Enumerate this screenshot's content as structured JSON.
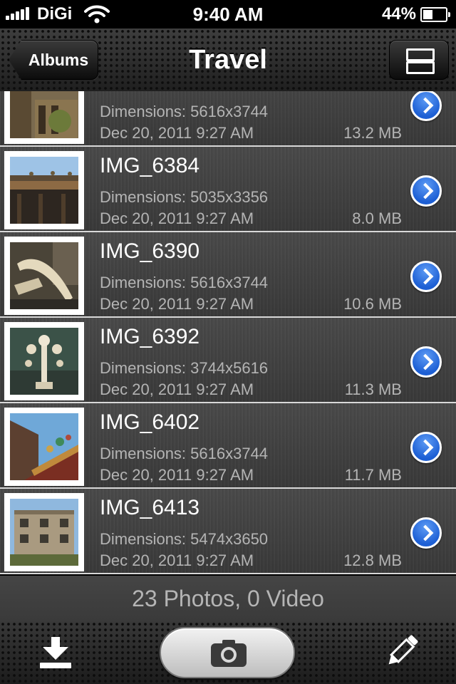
{
  "status_bar": {
    "carrier": "DiGi",
    "time": "9:40 AM",
    "battery_percent_label": "44%",
    "battery_level": 0.44,
    "signal_bars": 5
  },
  "nav": {
    "back_label": "Albums",
    "title": "Travel",
    "view_toggle_icon": "list-view-icon"
  },
  "photos": [
    {
      "title": "",
      "dimensions": "Dimensions: 5616x3744",
      "date": "Dec 20, 2011 9:27 AM",
      "size": "13.2 MB"
    },
    {
      "title": "IMG_6384",
      "dimensions": "Dimensions: 5035x3356",
      "date": "Dec 20, 2011 9:27 AM",
      "size": "8.0 MB"
    },
    {
      "title": "IMG_6390",
      "dimensions": "Dimensions: 5616x3744",
      "date": "Dec 20, 2011 9:27 AM",
      "size": "10.6 MB"
    },
    {
      "title": "IMG_6392",
      "dimensions": "Dimensions: 3744x5616",
      "date": "Dec 20, 2011 9:27 AM",
      "size": "11.3 MB"
    },
    {
      "title": "IMG_6402",
      "dimensions": "Dimensions: 5616x3744",
      "date": "Dec 20, 2011 9:27 AM",
      "size": "11.7 MB"
    },
    {
      "title": "IMG_6413",
      "dimensions": "Dimensions: 5474x3650",
      "date": "Dec 20, 2011 9:27 AM",
      "size": "12.8 MB"
    }
  ],
  "summary": "23 Photos, 0 Video",
  "toolbar": {
    "left_icon": "download-icon",
    "center_icon": "camera-icon",
    "right_icon": "pencil-icon"
  },
  "colors": {
    "accent_blue": "#1d5fd4",
    "row_separator": "#d8d8d8",
    "secondary_text": "#b4b4b4"
  }
}
